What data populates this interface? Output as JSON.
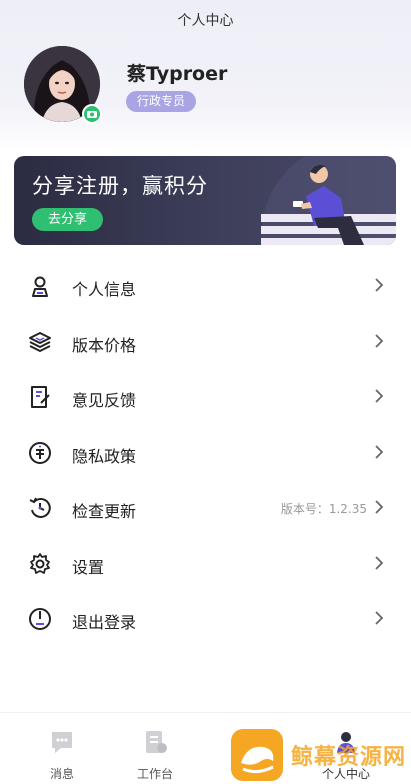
{
  "header": {
    "title": "个人中心"
  },
  "profile": {
    "name": "蔡Typroer",
    "role": "行政专员"
  },
  "banner": {
    "title": "分享注册，赢积分",
    "button": "去分享"
  },
  "menu": [
    {
      "label": "个人信息",
      "icon": "person-id-icon"
    },
    {
      "label": "版本价格",
      "icon": "layers-icon"
    },
    {
      "label": "意见反馈",
      "icon": "feedback-doc-icon"
    },
    {
      "label": "隐私政策",
      "icon": "privacy-shield-icon"
    },
    {
      "label": "检查更新",
      "icon": "clock-update-icon",
      "extra": "版本号：1.2.35"
    },
    {
      "label": "设置",
      "icon": "gear-icon"
    },
    {
      "label": "退出登录",
      "icon": "power-icon"
    }
  ],
  "tabs": [
    {
      "label": "消息",
      "icon": "message-icon"
    },
    {
      "label": "工作台",
      "icon": "workbench-icon"
    },
    {
      "label": "",
      "icon": "home-icon"
    },
    {
      "label": "个人中心",
      "icon": "profile-icon",
      "active": true
    }
  ],
  "watermark": {
    "text": "鲸幕资源网"
  },
  "colors": {
    "accent_green": "#2fbf71",
    "badge_purple": "#a9a4e4",
    "banner_dark": "#2b2c42",
    "active_tab": "#5b4fd6"
  }
}
